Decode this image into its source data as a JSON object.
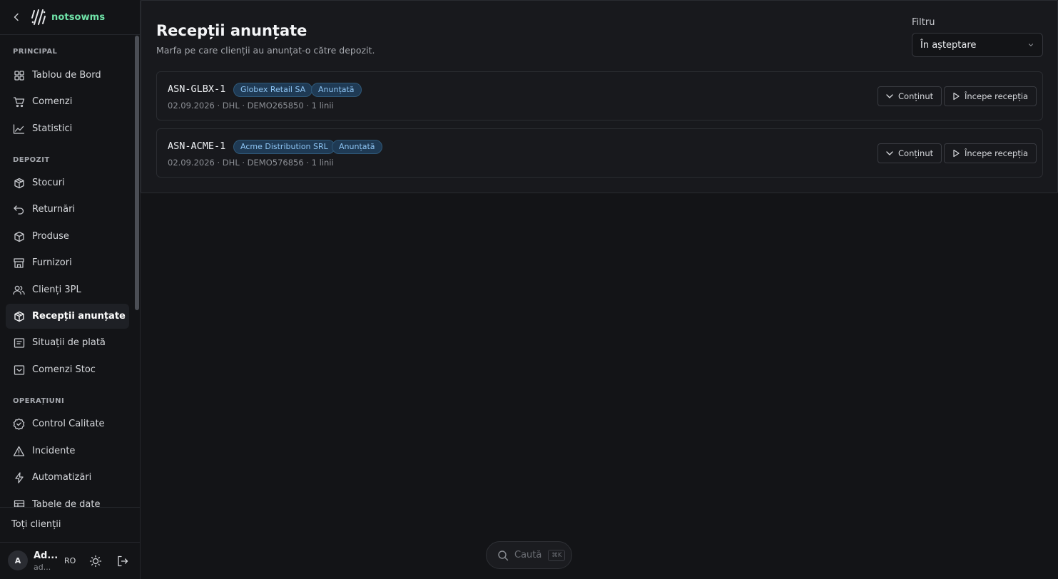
{
  "brand": {
    "name": "notsowms"
  },
  "sidebar": {
    "sections": [
      {
        "title": "PRINCIPAL",
        "items": [
          {
            "label": "Tablou de Bord",
            "icon": "dashboard-icon"
          },
          {
            "label": "Comenzi",
            "icon": "cart-icon"
          },
          {
            "label": "Statistici",
            "icon": "chart-line-icon"
          }
        ]
      },
      {
        "title": "DEPOZIT",
        "items": [
          {
            "label": "Stocuri",
            "icon": "box-icon"
          },
          {
            "label": "Returnări",
            "icon": "return-icon"
          },
          {
            "label": "Produse",
            "icon": "package-icon"
          },
          {
            "label": "Furnizori",
            "icon": "store-icon"
          },
          {
            "label": "Clienți 3PL",
            "icon": "users-icon"
          },
          {
            "label": "Recepții anunțate",
            "icon": "package-icon",
            "active": true
          },
          {
            "label": "Situații de plată",
            "icon": "receipt-icon"
          },
          {
            "label": "Comenzi Stoc",
            "icon": "inbox-icon"
          }
        ]
      },
      {
        "title": "OPERAȚIUNI",
        "items": [
          {
            "label": "Control Calitate",
            "icon": "badge-check-icon"
          },
          {
            "label": "Incidente",
            "icon": "warning-icon"
          },
          {
            "label": "Automatizări",
            "icon": "lightning-icon"
          },
          {
            "label": "Tabele de date",
            "icon": "table-icon"
          }
        ]
      }
    ],
    "footer": {
      "all_clients": "Toți clienții",
      "avatar_initial": "A",
      "user_name": "Ad...",
      "user_sub": "ad...",
      "language": "RO"
    }
  },
  "page": {
    "title": "Recepții anunțate",
    "subtitle": "Marfa pe care clienții au anunțat-o către depozit.",
    "filter": {
      "label": "Filtru",
      "value": "În așteptare"
    }
  },
  "asns": [
    {
      "code": "ASN-GLBX-1",
      "client": "Globex Retail SA",
      "status": "Anunțată",
      "meta": "02.09.2026 · DHL · DEMO265850 · 1 linii",
      "content_label": "Conținut",
      "start_label": "Începe recepția"
    },
    {
      "code": "ASN-ACME-1",
      "client": "Acme Distribution SRL",
      "status": "Anunțată",
      "meta": "02.09.2026 · DHL · DEMO576856 · 1 linii",
      "content_label": "Conținut",
      "start_label": "Începe recepția"
    }
  ],
  "search": {
    "placeholder": "Caută",
    "shortcut": "⌘K"
  }
}
